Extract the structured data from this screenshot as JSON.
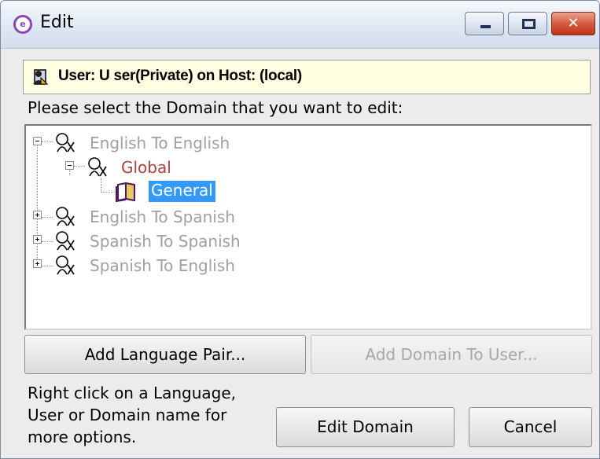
{
  "window": {
    "title": "Edit",
    "icon": "app-icon",
    "close_glyph": "✕"
  },
  "userbar": {
    "text": "User: U ser(Private) on Host: (local)",
    "icon": "user-icon"
  },
  "prompt": "Please select the Domain that you want to edit:",
  "tree": {
    "nodes": [
      {
        "label": "English To English",
        "expanded": true,
        "icon": "language-pair-icon"
      },
      {
        "label": "Global",
        "expanded": true,
        "icon": "user-group-icon"
      },
      {
        "label": "General",
        "selected": true,
        "icon": "book-icon"
      },
      {
        "label": "English To Spanish",
        "expanded": false,
        "icon": "language-pair-icon"
      },
      {
        "label": "Spanish To Spanish",
        "expanded": false,
        "icon": "language-pair-icon"
      },
      {
        "label": "Spanish To English",
        "expanded": false,
        "icon": "language-pair-icon"
      }
    ]
  },
  "buttons": {
    "add_language_pair": "Add Language Pair...",
    "add_domain_to_user": "Add Domain To User...",
    "edit_domain": "Edit Domain",
    "cancel": "Cancel"
  },
  "hint": "Right click on a Language, User or Domain name for more options.",
  "colors": {
    "selection": "#3399ff",
    "userbar_bg": "#ffffe1",
    "global_label": "#b04040",
    "disabled_text": "#a0a0a0"
  }
}
